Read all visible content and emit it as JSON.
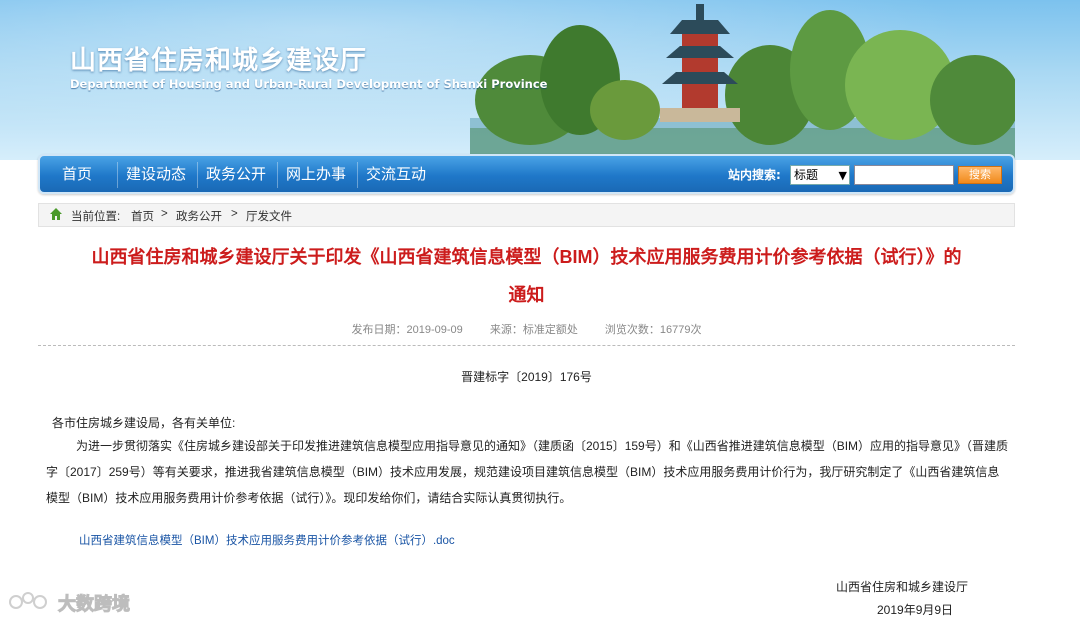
{
  "header": {
    "title": "山西省住房和城乡建设厅",
    "subtitle": "Department of Housing and Urban-Rural Development of Shanxi Province"
  },
  "nav": {
    "items": [
      "首页",
      "建设动态",
      "政务公开",
      "网上办事",
      "交流互动"
    ],
    "search_label": "站内搜索:",
    "search_select_value": "标题",
    "search_input_value": "",
    "search_button": "搜索"
  },
  "breadcrumb": {
    "label": "当前位置:",
    "items": [
      "首页",
      "政务公开",
      "厅发文件"
    ],
    "separator": ">"
  },
  "article": {
    "title_line1": "山西省住房和城乡建设厅关于印发《山西省建筑信息模型（BIM）技术应用服务费用计价参考依据（试行）》的",
    "title_line2": "通知",
    "publish_date": "发布日期：2019-09-09",
    "source": "来源：标准定额处",
    "views": "浏览次数：16779次",
    "doc_number": "晋建标字〔2019〕176号",
    "salutation": "各市住房城乡建设局，各有关单位:",
    "paragraph": "为进一步贯彻落实《住房城乡建设部关于印发推进建筑信息模型应用指导意见的通知》（建质函〔2015〕159号）和《山西省推进建筑信息模型（BIM）应用的指导意见》（晋建质字〔2017〕259号）等有关要求，推进我省建筑信息模型（BIM）技术应用发展，规范建设项目建筑信息模型（BIM）技术应用服务费用计价行为，我厅研究制定了《山西省建筑信息模型（BIM）技术应用服务费用计价参考依据（试行）》。现印发给你们，请结合实际认真贯彻执行。",
    "attachment": "山西省建筑信息模型（BIM）技术应用服务费用计价参考依据（试行）.doc",
    "signature_org": "山西省住房和城乡建设厅",
    "signature_date": "2019年9月9日"
  },
  "watermark": {
    "text": "大数跨境"
  },
  "colors": {
    "nav_blue": "#1f78c9",
    "title_red": "#cc1c1c",
    "link_blue": "#1a55a5",
    "search_orange": "#f08a1c"
  }
}
